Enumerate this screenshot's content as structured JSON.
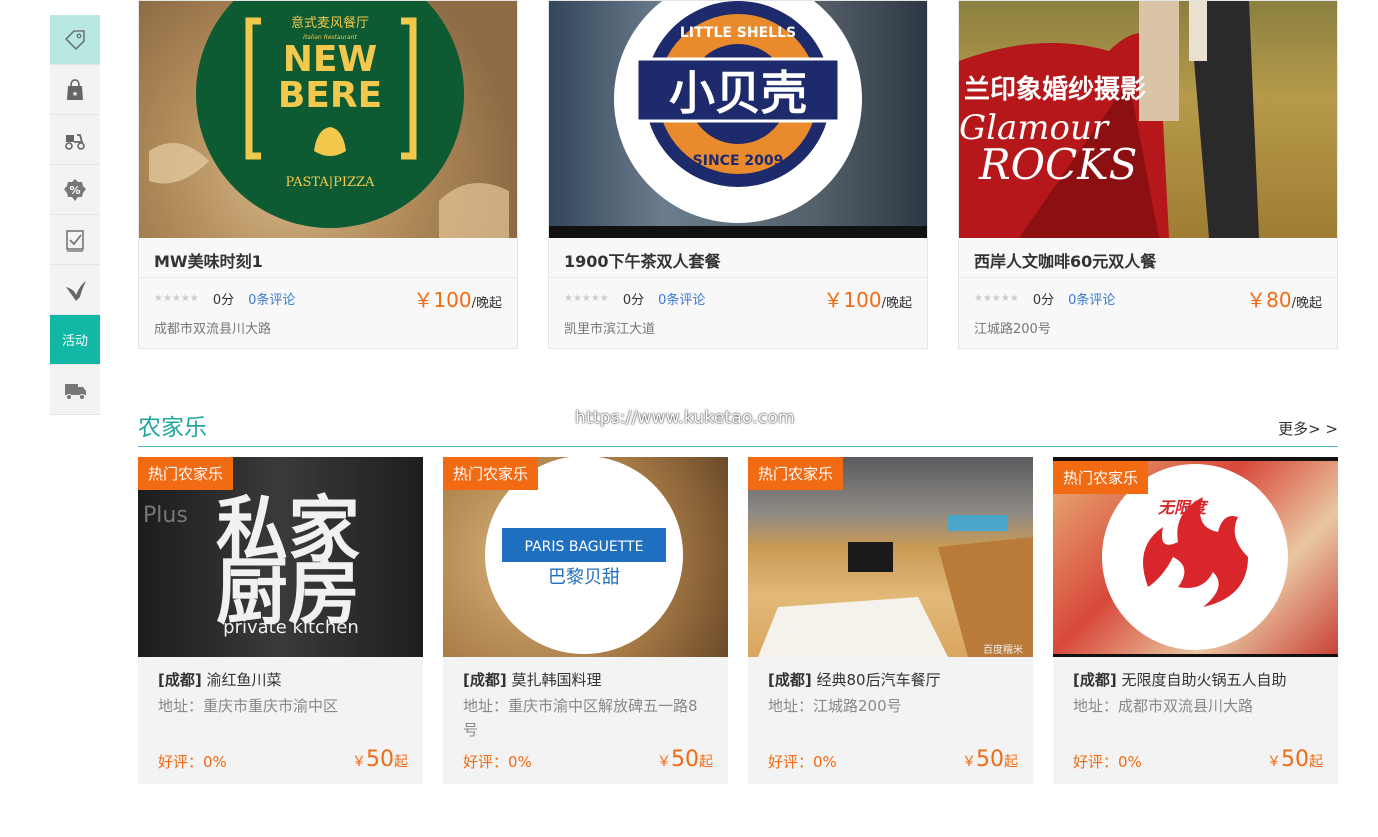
{
  "sidenav": {
    "items": [
      {
        "icon": "tag-icon"
      },
      {
        "icon": "shopping-bag-icon"
      },
      {
        "icon": "scooter-icon"
      },
      {
        "icon": "percent-icon"
      },
      {
        "icon": "checklist-icon"
      },
      {
        "icon": "bird-icon"
      },
      {
        "label": "活动"
      },
      {
        "icon": "truck-icon"
      }
    ]
  },
  "top_cards": [
    {
      "logo_top": "意式麦风餐厅",
      "logo_sub": "Italian Restaurant",
      "logo_main": "NEW\nBERE",
      "logo_bottom": "PASTA|PIZZA",
      "title": "MW美味时刻1",
      "score": "0分",
      "comments": "0条评论",
      "price": "￥100",
      "unit": "/晚起",
      "address": "成都市双流县川大路"
    },
    {
      "logo_main": "小贝壳",
      "logo_ring_top": "LITTLE SHELLS",
      "logo_ring_bottom": "SINCE 2009",
      "title": "1900下午茶双人套餐",
      "score": "0分",
      "comments": "0条评论",
      "price": "￥100",
      "unit": "/晚起",
      "address": "凯里市滨江大道"
    },
    {
      "logo_main": "兰印象婚纱摄影",
      "logo_script1": "Glamour",
      "logo_script2": "ROCKS",
      "title": "西岸人文咖啡60元双人餐",
      "score": "0分",
      "comments": "0条评论",
      "price": "￥80",
      "unit": "/晚起",
      "address": "江城路200号"
    }
  ],
  "section": {
    "title": "农家乐",
    "more": "更多> >",
    "watermark": "https://www.kuketao.com"
  },
  "farm_cards": [
    {
      "tag": "热门农家乐",
      "img_text1": "私家",
      "img_text2": "厨房",
      "img_text3": "private kitchen",
      "img_text4": "Plus",
      "city": "[成都]",
      "name": "渝红鱼川菜",
      "address": "地址：重庆市重庆市渝中区",
      "rating": "好评：0%",
      "price": "50",
      "price_prefix": "￥",
      "price_suffix": "起"
    },
    {
      "tag": "热门农家乐",
      "img_text1": "PARIS BAGUETTE",
      "img_text2": "巴黎贝甜",
      "city": "[成都]",
      "name": "莫扎韩国料理",
      "address": "地址：重庆市渝中区解放碑五一路8号",
      "rating": "好评：0%",
      "price": "50",
      "price_prefix": "￥",
      "price_suffix": "起"
    },
    {
      "tag": "热门农家乐",
      "img_text1": "百度糯米",
      "city": "[成都]",
      "name": "经典80后汽车餐厅",
      "address": "地址：江城路200号",
      "rating": "好评：0%",
      "price": "50",
      "price_prefix": "￥",
      "price_suffix": "起"
    },
    {
      "tag": "热门农家乐",
      "img_text1": "无限度",
      "city": "[成都]",
      "name": "无限度自助火锅五人自助",
      "address": "地址：成都市双流县川大路",
      "rating": "好评：0%",
      "price": "50",
      "price_prefix": "￥",
      "price_suffix": "起"
    }
  ],
  "colors": {
    "accent": "#22a7a0",
    "price": "#f26a12",
    "link": "#3a7ad1"
  }
}
